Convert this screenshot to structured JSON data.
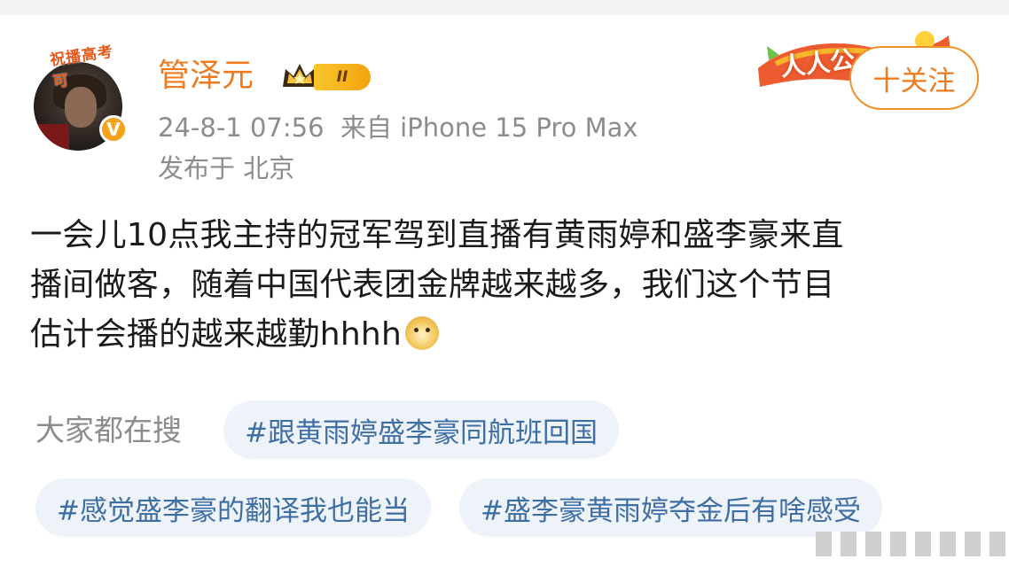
{
  "author": {
    "name": "管泽元",
    "pendant_text": "祝播高考可",
    "verified_mark": "V",
    "level_badge": "II"
  },
  "post": {
    "timestamp": "24-8-1 07:56",
    "source": "来自 iPhone 15 Pro Max",
    "location": "发布于 北京",
    "content_lines": [
      "一会儿10点我主持的冠军驾到直播有黄雨婷和盛李豪来直",
      "播间做客，随着中国代表团金牌越来越多，我们这个节目",
      "估计会播的越来越勤hhhh"
    ],
    "emoji": "doge-emoji"
  },
  "decoration": {
    "banner_text": "人人公"
  },
  "follow_button": {
    "label": "十关注"
  },
  "search": {
    "label": "大家都在搜",
    "tags": [
      "#跟黄雨婷盛李豪同航班回国",
      "#感觉盛李豪的翻译我也能当",
      "#盛李豪黄雨婷夺金后有啥感受"
    ]
  },
  "colors": {
    "accent_orange": "#ee7b1f",
    "meta_gray": "#8c8c8c",
    "tag_text_blue": "#3e6ea4",
    "tag_bg": "#eef3f9"
  }
}
